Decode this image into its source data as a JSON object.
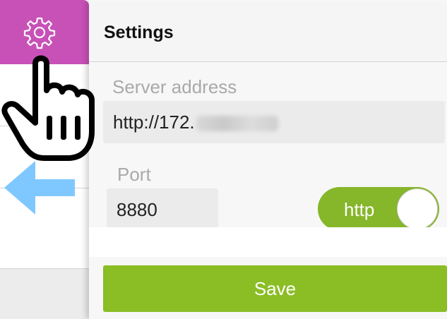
{
  "header": {
    "title": "Settings"
  },
  "server": {
    "label": "Server address",
    "value": "http://172."
  },
  "port": {
    "label": "Port",
    "value": "8880"
  },
  "protocol": {
    "label": "http",
    "on": true
  },
  "actions": {
    "save_label": "Save"
  },
  "icons": {
    "settings": "gear-icon",
    "back": "arrow-left-icon",
    "cursor": "hand-pointer-icon"
  },
  "colors": {
    "accent_pink": "#c851b8",
    "toggle_green": "#86b62a",
    "save_green": "#8bbd25",
    "arrow_blue": "#7ec8ff"
  }
}
